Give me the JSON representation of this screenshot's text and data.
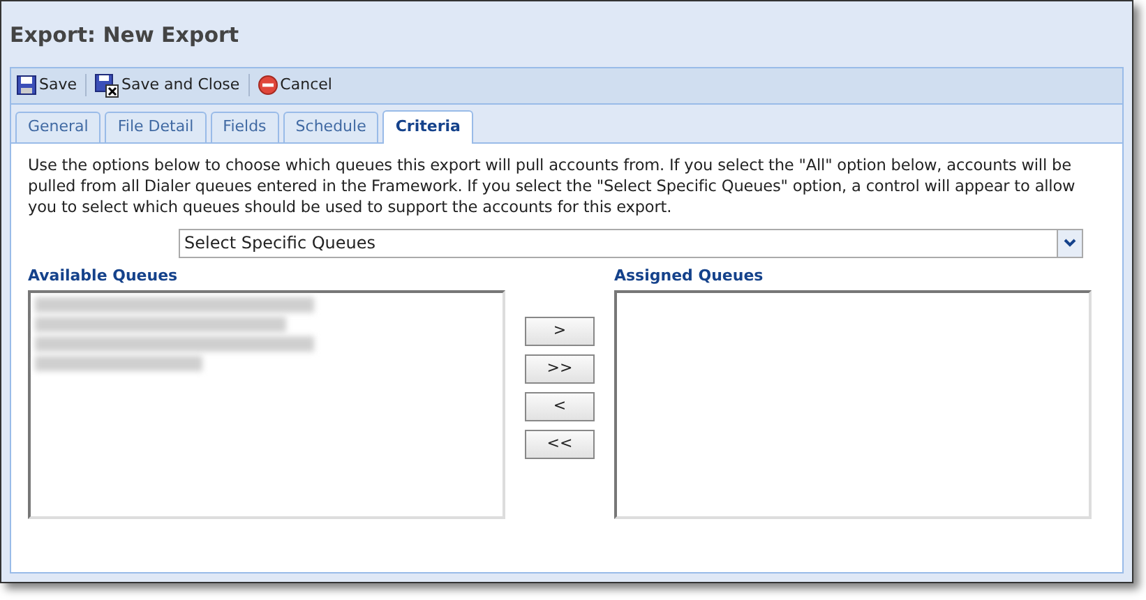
{
  "window": {
    "title": "Export: New Export"
  },
  "toolbar": [
    {
      "kind": "save",
      "label": "Save"
    },
    {
      "kind": "save_close",
      "label": "Save and Close"
    },
    {
      "kind": "cancel",
      "label": "Cancel"
    }
  ],
  "tabs": [
    {
      "label": "General",
      "selected": false
    },
    {
      "label": "File Detail",
      "selected": false
    },
    {
      "label": "Fields",
      "selected": false
    },
    {
      "label": "Schedule",
      "selected": false
    },
    {
      "label": "Criteria",
      "selected": true
    }
  ],
  "description": "Use the options below to choose which queues this export will pull accounts from. If you select the \"All\" option below, accounts will be pulled from all Dialer queues entered in the Framework. If you select the \"Select Specific Queues\" option, a control will appear to allow you to select which queues should be used to support the accounts for this export.",
  "queue_mode": {
    "value": "Select Specific Queues"
  },
  "available_queues": {
    "label": "Available Queues"
  },
  "move_buttons": [
    ">",
    ">>",
    "<",
    "<<"
  ],
  "assigned_queues": {
    "label": "Assigned Queues"
  }
}
